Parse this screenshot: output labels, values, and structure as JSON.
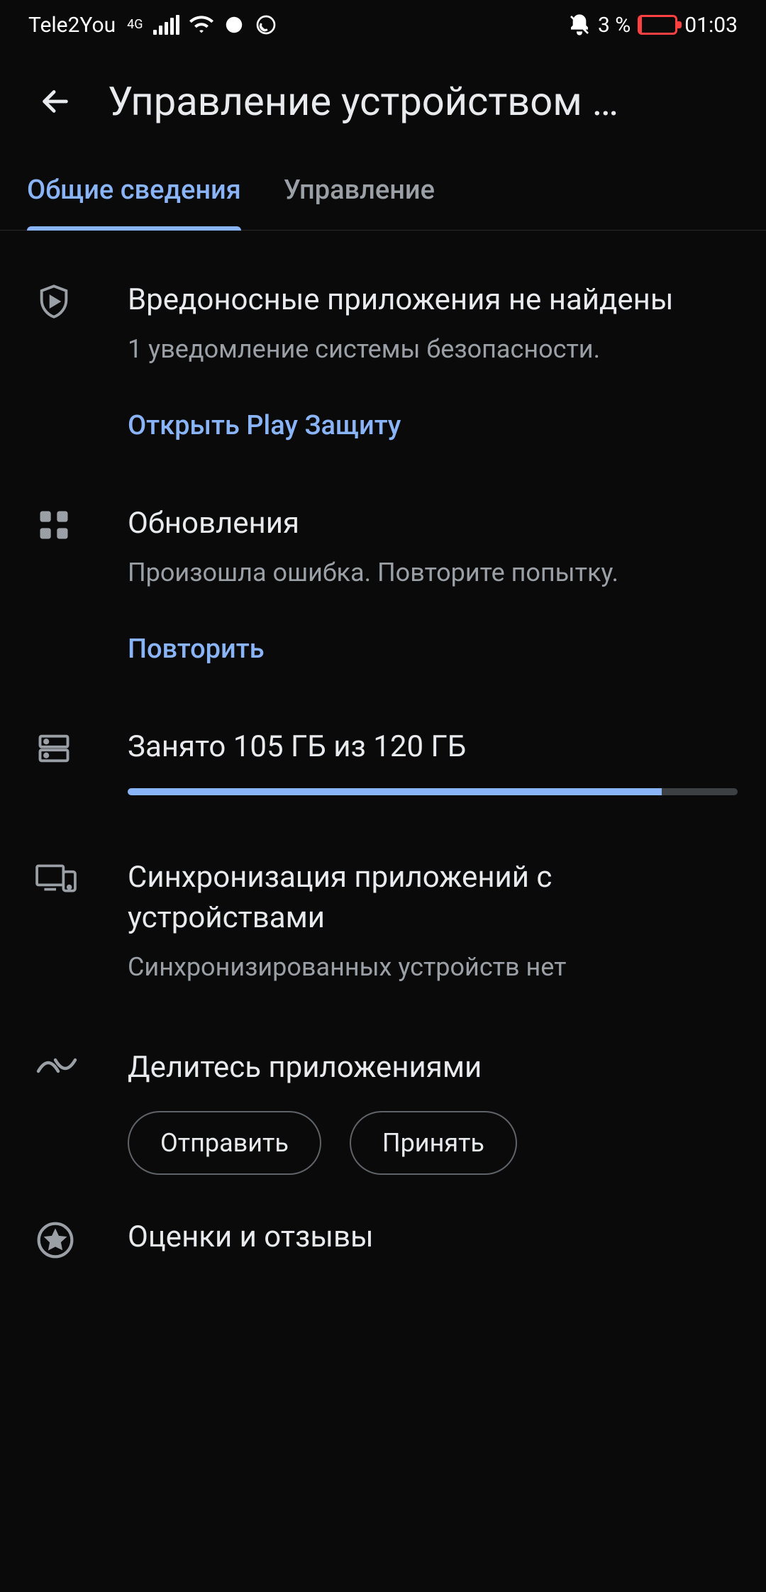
{
  "status": {
    "carrier": "Tele2You",
    "network": "4G",
    "battery_percent": "3 %",
    "time": "01:03"
  },
  "header": {
    "title": "Управление устройством …"
  },
  "tabs": [
    {
      "label": "Общие сведения",
      "active": true
    },
    {
      "label": "Управление",
      "active": false
    }
  ],
  "protect": {
    "title": "Вредоносные приложения не найдены",
    "subtitle": "1 уведомление системы безопасности.",
    "action": "Открыть Play Защиту"
  },
  "updates": {
    "title": "Обновления",
    "subtitle": "Произошла ошибка. Повторите попытку.",
    "action": "Повторить"
  },
  "storage": {
    "title": "Занято 105 ГБ из 120 ГБ",
    "used_gb": 105,
    "total_gb": 120,
    "percent": 87.5
  },
  "sync": {
    "title": "Синхронизация приложений с устройствами",
    "subtitle": "Синхронизированных устройств нет"
  },
  "share": {
    "title": "Делитесь приложениями",
    "send_label": "Отправить",
    "receive_label": "Принять"
  },
  "ratings": {
    "title": "Оценки и отзывы"
  }
}
